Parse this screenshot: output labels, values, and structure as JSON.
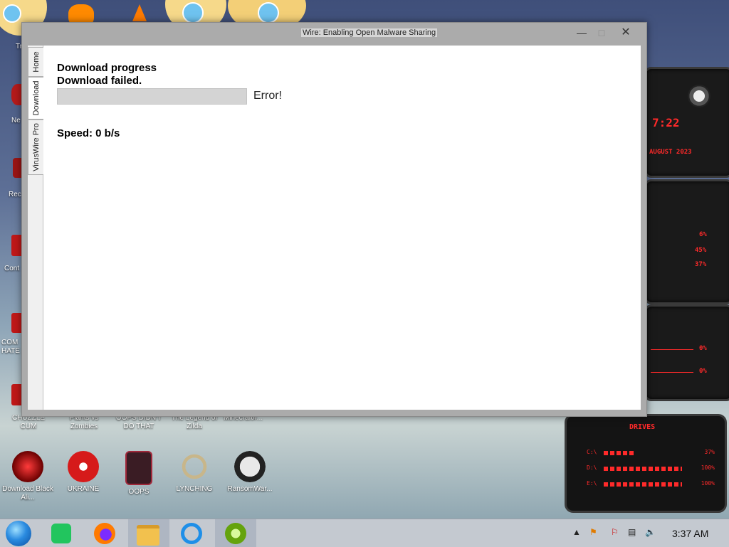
{
  "window": {
    "title": "Wire: Enabling Open Malware Sharing",
    "tabs": [
      {
        "label": "Home"
      },
      {
        "label": "Download"
      },
      {
        "label": "VirusWire Pro"
      }
    ],
    "active_tab": "Download",
    "content": {
      "heading": "Download progress",
      "status": "Download failed.",
      "progress_percent": 0,
      "error_text": "Error!",
      "speed": "Speed: 0 b/s"
    }
  },
  "desktop_icons": [
    {
      "label": "Download Black Ali...",
      "icon": "alien-red-icon"
    },
    {
      "label": "UKRAINE",
      "icon": "radiation-icon"
    },
    {
      "label": "OOPS",
      "icon": "oops-app-icon"
    },
    {
      "label": "LYNCHING",
      "icon": "noose-icon"
    },
    {
      "label": "RansomWar...",
      "icon": "skull-icon"
    }
  ],
  "partial_icon_labels": {
    "row1": [
      "CHUZZLE CUM",
      "Plants vs Zombies",
      "OOPS DIDN'T DO THAT",
      "The Legend of Zilda",
      "Minecraft#..."
    ],
    "left_edge": [
      "Tr",
      "Ne",
      "Rec",
      "Cont",
      "COM HATE"
    ]
  },
  "gadget": {
    "time": "7:22",
    "date": "AUGUST 2023",
    "system_pcts": [
      "6%",
      "45%",
      "37%"
    ],
    "network_pcts": [
      "0%",
      "0%"
    ],
    "drives_title": "DRIVES",
    "drives": [
      {
        "label": "C:\\",
        "pct": "37%"
      },
      {
        "label": "D:\\",
        "pct": "100%"
      },
      {
        "label": "E:\\",
        "pct": "100%"
      }
    ],
    "accent": "#ff2a2a"
  },
  "taskbar": {
    "apps": [
      "start-orb-icon",
      "notes-app-icon",
      "firefox-icon",
      "file-explorer-icon",
      "internet-explorer-icon",
      "lime-app-icon"
    ],
    "tray": [
      "chevron-up-icon",
      "flag-icon",
      "action-center-icon",
      "network-icon",
      "volume-icon"
    ],
    "time": "3:37 AM"
  }
}
